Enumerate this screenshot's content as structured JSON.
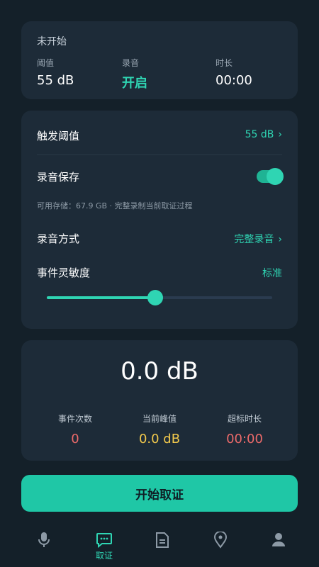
{
  "status": {
    "title": "未开始",
    "threshold_label": "阈值",
    "threshold_value": "55 dB",
    "recording_label": "录音",
    "recording_value": "开启",
    "duration_label": "时长",
    "duration_value": "00:00"
  },
  "settings": {
    "trigger_label": "触发阈值",
    "trigger_value": "55 dB",
    "save_label": "录音保存",
    "save_enabled": true,
    "storage_hint": "可用存储：67.9 GB · 完整录制当前取证过程",
    "mode_label": "录音方式",
    "mode_value": "完整录音",
    "sensitivity_label": "事件灵敏度",
    "sensitivity_value": "标准",
    "sensitivity_level": 0.48
  },
  "meter": {
    "current": "0.0 dB",
    "events_label": "事件次数",
    "events_value": "0",
    "peak_label": "当前峰值",
    "peak_value": "0.0 dB",
    "over_label": "超标时长",
    "over_value": "00:00"
  },
  "start_button": "开始取证",
  "nav": {
    "active_label": "取证",
    "items": [
      "microphone-icon",
      "chat-evidence-icon",
      "document-icon",
      "location-pin-icon",
      "user-icon"
    ]
  },
  "colors": {
    "accent": "#2fd5b3",
    "peak": "#f2c94c",
    "alert": "#eb6a6a",
    "inactive_icon": "#8d9aa6"
  }
}
